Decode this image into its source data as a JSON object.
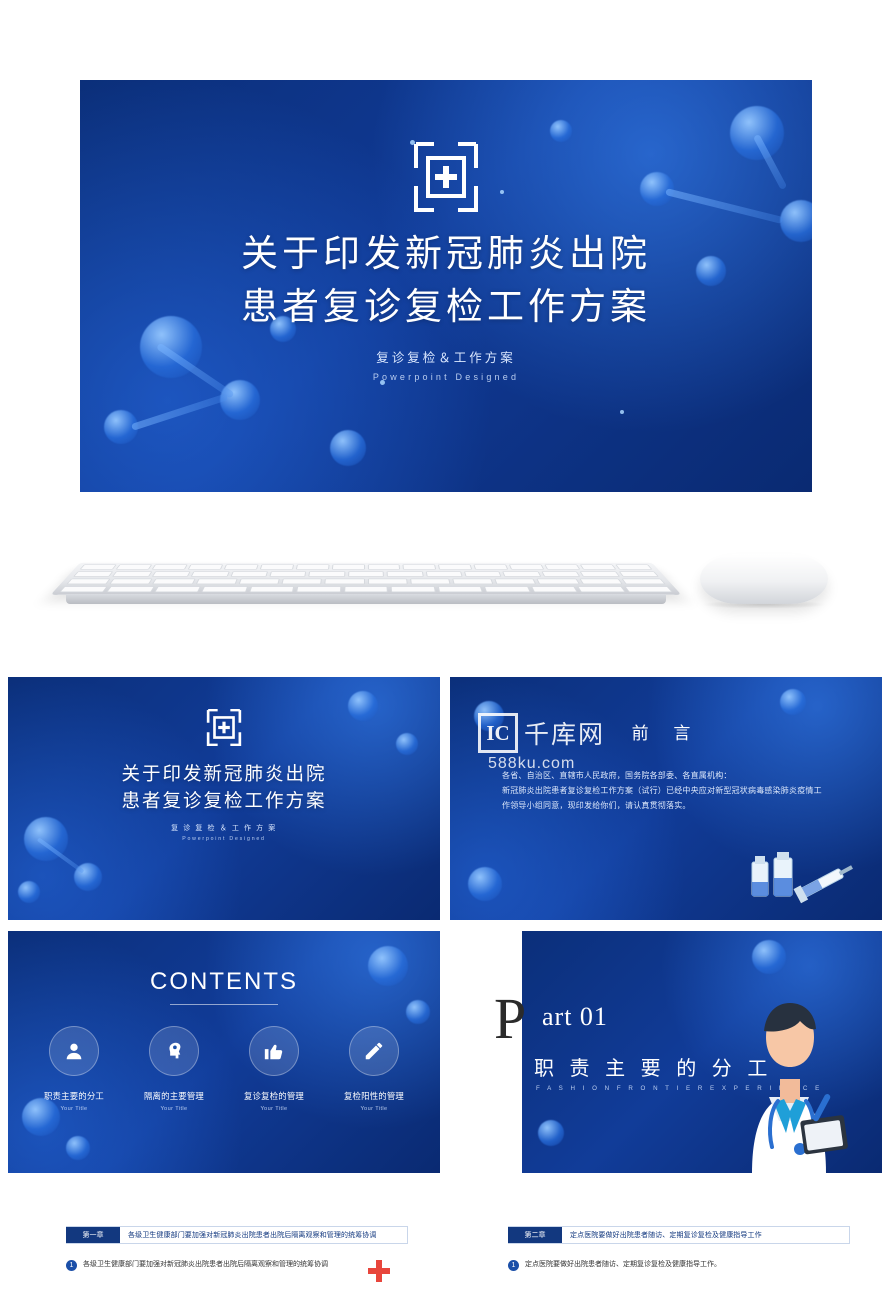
{
  "hero": {
    "logo_icon": "hospital-cross-icon",
    "title_line1": "关于印发新冠肺炎出院",
    "title_line2": "患者复诊复检工作方案",
    "subtitle": "复诊复检＆工作方案",
    "subtitle_en": "Powerpoint Designed"
  },
  "watermark": {
    "box_letter": "IC",
    "text": "千库网",
    "sub": "588ku.com"
  },
  "slides": {
    "cover": {
      "title_line1": "关于印发新冠肺炎出院",
      "title_line2": "患者复诊复检工作方案",
      "subtitle": "复 诊 复 检 ＆ 工 作 方 案",
      "subtitle_en": "Powerpoint Designed"
    },
    "preface": {
      "title": "前 言",
      "paragraphs": [
        "各省、自治区、直辖市人民政府，国务院各部委、各直属机构：",
        "新冠肺炎出院患者复诊复检工作方案（试行）已经中央应对新型冠状病毒感染肺炎疫情工作领导小组同意，现印发给你们，请认真贯彻落实。"
      ],
      "illustration_icon": "vaccine-syringe-icon"
    },
    "contents": {
      "title": "CONTENTS",
      "items": [
        {
          "icon": "user-icon",
          "label": "职责主要的分工",
          "sub": "Your Title"
        },
        {
          "icon": "head-idea-icon",
          "label": "隔离的主要管理",
          "sub": "Your Title"
        },
        {
          "icon": "thumbs-up-icon",
          "label": "复诊复检的管理",
          "sub": "Your Title"
        },
        {
          "icon": "pencil-icon",
          "label": "复检阳性的管理",
          "sub": "Your Title"
        }
      ]
    },
    "part01": {
      "p_letter": "P",
      "art_text": "art 01",
      "chinese_title": "职 责 主 要 的 分 工",
      "english_sub": "F A S H I O N   F R O N T I E R   E X P E R I E N C E",
      "illustration_icon": "doctor-icon"
    },
    "section_left": {
      "tag": "第一章",
      "heading": "各级卫生健康部门要加强对新冠肺炎出院患者出院后隔离观察和管理的统筹协调",
      "item_number": "1",
      "item_text": "各级卫生健康部门要加强对新冠肺炎出院患者出院后隔离观察和管理的统筹协调",
      "icon": "medical-cross-icon"
    },
    "section_right": {
      "tag": "第二章",
      "heading": "定点医院要做好出院患者随访、定期复诊复检及健康指导工作",
      "item_number": "1",
      "item_text": "定点医院要做好出院患者随访、定期复诊复检及健康指导工作。",
      "icon": "medical-cross-icon"
    }
  },
  "colors": {
    "brand_blue": "#12387f",
    "accent_blue": "#1b4fa8",
    "page_bg": "#ffffff"
  }
}
